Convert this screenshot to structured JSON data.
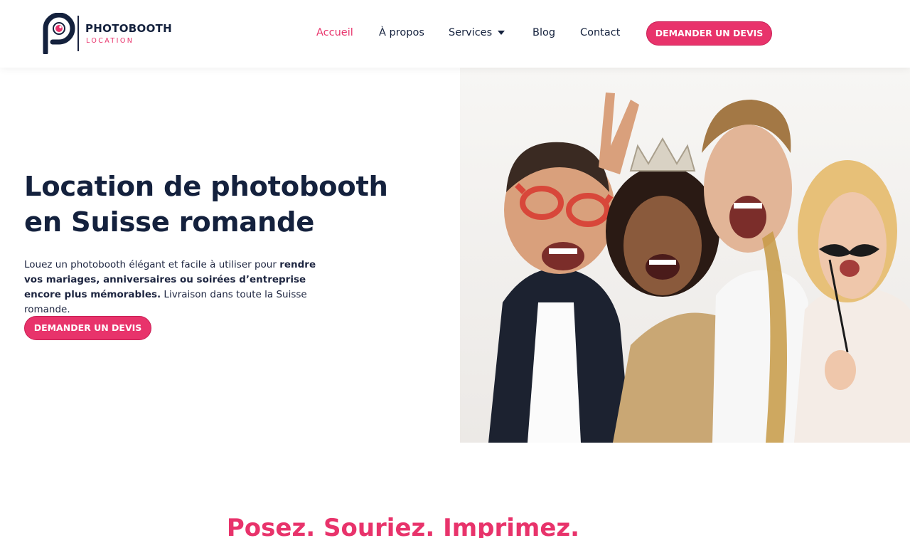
{
  "brand": {
    "name": "PHOTOBOOTH",
    "sub": "LOCATION",
    "accent_color": "#e8336b",
    "dark_color": "#14213d"
  },
  "nav": {
    "items": [
      {
        "label": "Accueil",
        "active": true
      },
      {
        "label": "À propos"
      },
      {
        "label": "Services",
        "icon": "caret-down-icon"
      },
      {
        "label": "Blog"
      },
      {
        "label": "Contact"
      }
    ],
    "cta": "DEMANDER UN DEVIS"
  },
  "hero": {
    "title_line1": "Location de photobooth",
    "title_line2": "en Suisse romande",
    "desc_plain1": "Louez un photobooth élégant et facile à utiliser pour ",
    "desc_bold": "rendre vos mariages, anniversaires ou soirées d’entreprise encore plus mémorables.",
    "desc_plain2": " Livraison dans toute la Suisse romande.",
    "cta": "DEMANDER UN DEVIS"
  },
  "tagline": "Posez. Souriez. Imprimez."
}
